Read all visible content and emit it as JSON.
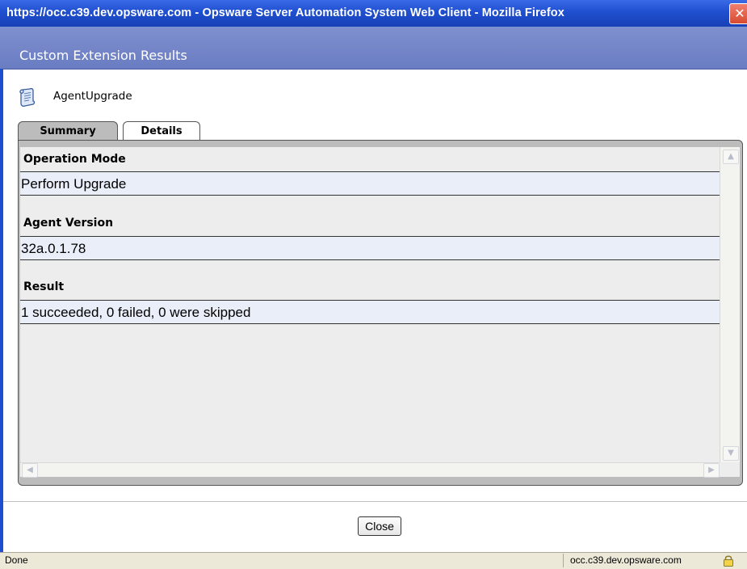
{
  "window": {
    "title": "https://occ.c39.dev.opsware.com - Opsware Server Automation System Web Client - Mozilla Firefox",
    "close_glyph": "✕"
  },
  "dialog": {
    "title": "Custom Extension Results"
  },
  "extension": {
    "icon": "script-scroll-icon",
    "name": "AgentUpgrade"
  },
  "tabs": [
    {
      "label": "Summary",
      "selected": true
    },
    {
      "label": "Details",
      "selected": false
    }
  ],
  "summary": {
    "sections": [
      {
        "heading": "Operation Mode",
        "value": "Perform Upgrade"
      },
      {
        "heading": "Agent Version",
        "value": "32a.0.1.78"
      },
      {
        "heading": "Result",
        "value": "1 succeeded, 0 failed, 0 were skipped"
      }
    ]
  },
  "buttons": {
    "close_label": "Close"
  },
  "statusbar": {
    "status": "Done",
    "domain": "occ.c39.dev.opsware.com",
    "lock_icon": "padlock-icon"
  },
  "colors": {
    "titlebar": "#1f4fcf",
    "dialog_header": "#7586c8",
    "value_row": "#e9eef9",
    "panel_bg": "#ededed"
  }
}
